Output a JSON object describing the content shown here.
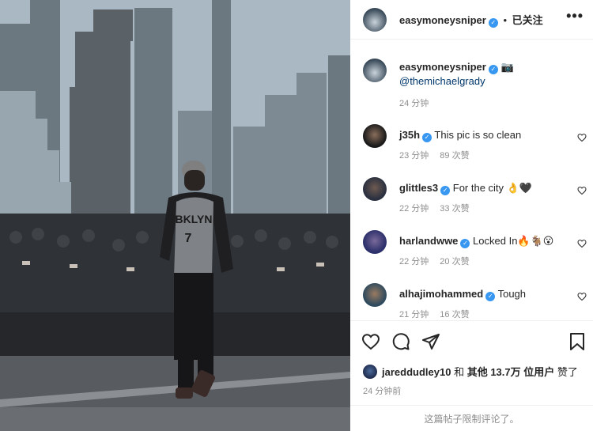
{
  "post": {
    "author": "easymoneysniper",
    "follow_dot": "•",
    "follow_status": "已关注",
    "more_label": "•••"
  },
  "caption": {
    "author": "easymoneysniper",
    "camera_emoji": "📷",
    "mention": "@themichaelgrady",
    "time": "24 分钟"
  },
  "comments": [
    {
      "user": "j35h",
      "text": "This pic is so clean",
      "time": "23 分钟",
      "likes": "89 次赞"
    },
    {
      "user": "glittles3",
      "text": "For the city 👌🖤",
      "time": "22 分钟",
      "likes": "33 次赞"
    },
    {
      "user": "harlandwwe",
      "text": "Locked In🔥🐐😮",
      "time": "22 分钟",
      "likes": "20 次赞"
    },
    {
      "user": "alhajimohammed",
      "text": "Tough",
      "time": "21 分钟",
      "likes": "16 次赞"
    }
  ],
  "likes": {
    "user": "jareddudley10",
    "and": "和",
    "others": "其他 13.7万 位用户",
    "liked": "赞了"
  },
  "post_time": "24 分钟前",
  "comments_restricted": "这篇帖子限制评论了。",
  "jersey": {
    "team": "BKLYN",
    "number": "7"
  },
  "colors": {
    "verified": "#3897f0",
    "mention": "#00376b",
    "secondary_text": "#8e8e8e",
    "border": "#efefef"
  },
  "icons": [
    "verified-icon",
    "more-icon",
    "heart-icon",
    "comment-icon",
    "share-icon",
    "bookmark-icon",
    "camera-emoji"
  ]
}
